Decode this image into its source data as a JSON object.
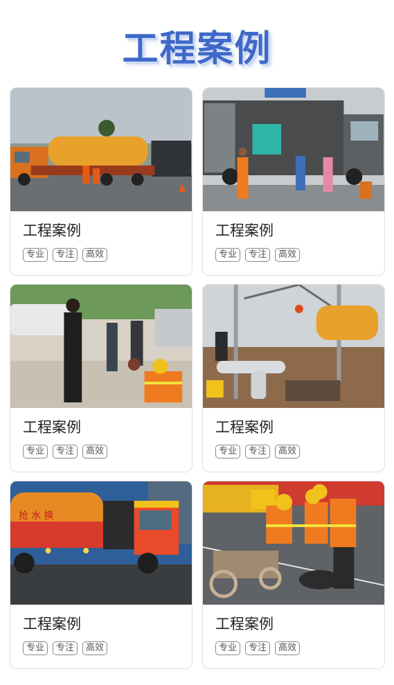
{
  "header": {
    "title": "工程案例"
  },
  "cards": [
    {
      "title": "工程案例",
      "tags": [
        "专业",
        "专注",
        "高效"
      ],
      "photo_icon": "sewage-truck-photo"
    },
    {
      "title": "工程案例",
      "tags": [
        "专业",
        "专注",
        "高效"
      ],
      "photo_icon": "box-truck-workers-photo"
    },
    {
      "title": "工程案例",
      "tags": [
        "专业",
        "专注",
        "高效"
      ],
      "photo_icon": "street-workers-photo"
    },
    {
      "title": "工程案例",
      "tags": [
        "专业",
        "专注",
        "高效"
      ],
      "photo_icon": "excavation-site-photo"
    },
    {
      "title": "工程案例",
      "tags": [
        "专业",
        "专注",
        "高效"
      ],
      "photo_icon": "tanker-truck-photo"
    },
    {
      "title": "工程案例",
      "tags": [
        "专业",
        "专注",
        "高效"
      ],
      "photo_icon": "manhole-workers-photo"
    }
  ],
  "truck_lettering": "抢 水 换"
}
